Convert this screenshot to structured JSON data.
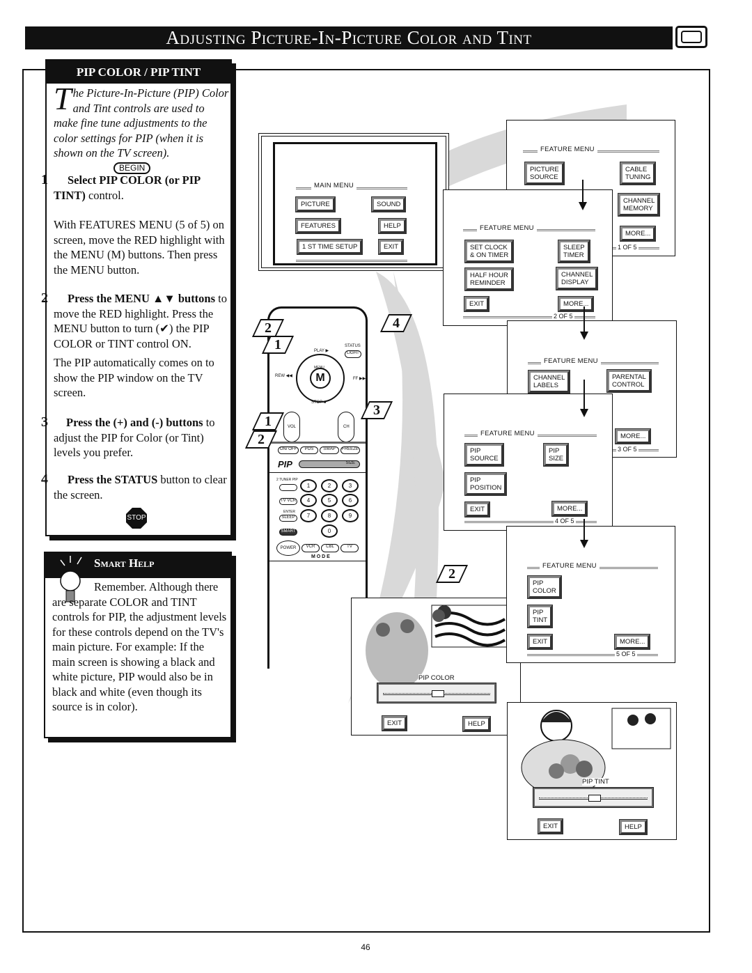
{
  "title": "Adjusting Picture-In-Picture Color and Tint",
  "left": {
    "heading": "PIP COLOR / PIP TINT",
    "intro_drop": "T",
    "intro": "he Picture-In-Picture (PIP) Color and Tint controls are used to make fine tune adjustments to the color settings for PIP (when it is shown on the TV screen).",
    "begin": "BEGIN",
    "steps": [
      {
        "num": "1",
        "bold": "Select PIP COLOR (or PIP TINT)",
        "rest": " control.",
        "extra": "With FEATURES MENU (5 of 5) on screen, move the RED highlight with the MENU (M)       buttons. Then press the MENU button."
      },
      {
        "num": "2",
        "bold": "Press the MENU ▲▼  buttons",
        "rest": " to move the RED highlight. Press the MENU button to turn (✔) the PIP COLOR or TINT control ON.",
        "extra": "The PIP automatically comes on to show the PIP window on the TV screen."
      },
      {
        "num": "3",
        "bold": "Press the (+) and (-) buttons",
        "rest": " to adjust the PIP for Color (or Tint) levels you prefer.",
        "extra": ""
      },
      {
        "num": "4",
        "bold": "Press the STATUS",
        "rest": " button to clear the screen.",
        "extra": ""
      }
    ],
    "stop": "STOP"
  },
  "smart_help": {
    "heading": "Smart Help",
    "text": "Remember. Although there are separate COLOR and TINT controls for PIP, the adjustment levels for these controls depend on the TV's main picture. For example: If the main screen is showing a black and white picture, PIP would also be in black and white (even though its source is in color)."
  },
  "menus": [
    {
      "title": "MAIN MENU",
      "buttons": [
        "PICTURE",
        "SOUND",
        "FEATURES",
        "HELP",
        "1 ST TIME SETUP",
        "EXIT"
      ],
      "page": ""
    },
    {
      "title": "FEATURE MENU",
      "buttons": [
        "PICTURE\nSOURCE",
        "CABLE\nTUNING",
        "CHANNEL\nMEMORY",
        "MORE..."
      ],
      "page": "1 OF 5"
    },
    {
      "title": "FEATURE MENU",
      "buttons": [
        "SET CLOCK\n& ON TIMER",
        "SLEEP\nTIMER",
        "HALF HOUR\nREMINDER",
        "CHANNEL\nDISPLAY",
        "EXIT",
        "MORE..."
      ],
      "page": "2 OF 5"
    },
    {
      "title": "FEATURE MENU",
      "buttons": [
        "CHANNEL\nLABELS",
        "PARENTAL\nCONTROL",
        "MORE..."
      ],
      "page": "3 OF 5"
    },
    {
      "title": "FEATURE MENU",
      "buttons": [
        "PIP\nSOURCE",
        "PIP\nSIZE",
        "PIP\nPOSITION",
        "EXIT",
        "MORE..."
      ],
      "page": "4 OF 5"
    },
    {
      "title": "FEATURE MENU",
      "buttons": [
        "PIP\nCOLOR",
        "PIP\nTINT",
        "EXIT",
        "MORE..."
      ],
      "page": "5 OF 5"
    }
  ],
  "pip_color": {
    "label": "PIP COLOR",
    "exit": "EXIT",
    "help": "HELP",
    "level": 0.5
  },
  "pip_tint": {
    "label": "PIP TINT",
    "exit": "EXIT",
    "help": "HELP",
    "level": 0.5
  },
  "remote": {
    "labels": [
      "PLAY ▶",
      "STATUS",
      "LIGHT",
      "MENU",
      "M",
      "REW ◀◀",
      "FF ▶▶",
      "STOP ■",
      "VOL",
      "CH",
      "ON/ OFF",
      "POS",
      "SWAP",
      "FREEZE",
      "PIP",
      "SIZE",
      "2 TUNER PIP",
      "TV VCR",
      "ENTER",
      "SLEEP",
      "SMART",
      "POWER",
      "VCR",
      "CBL",
      "TV",
      "M  O  D  E"
    ],
    "numbers": [
      "1",
      "2",
      "3",
      "4",
      "5",
      "6",
      "7",
      "8",
      "9",
      "0"
    ]
  },
  "callouts": [
    "2",
    "1",
    "4",
    "3",
    "1",
    "2",
    "2"
  ],
  "page_number": "46"
}
